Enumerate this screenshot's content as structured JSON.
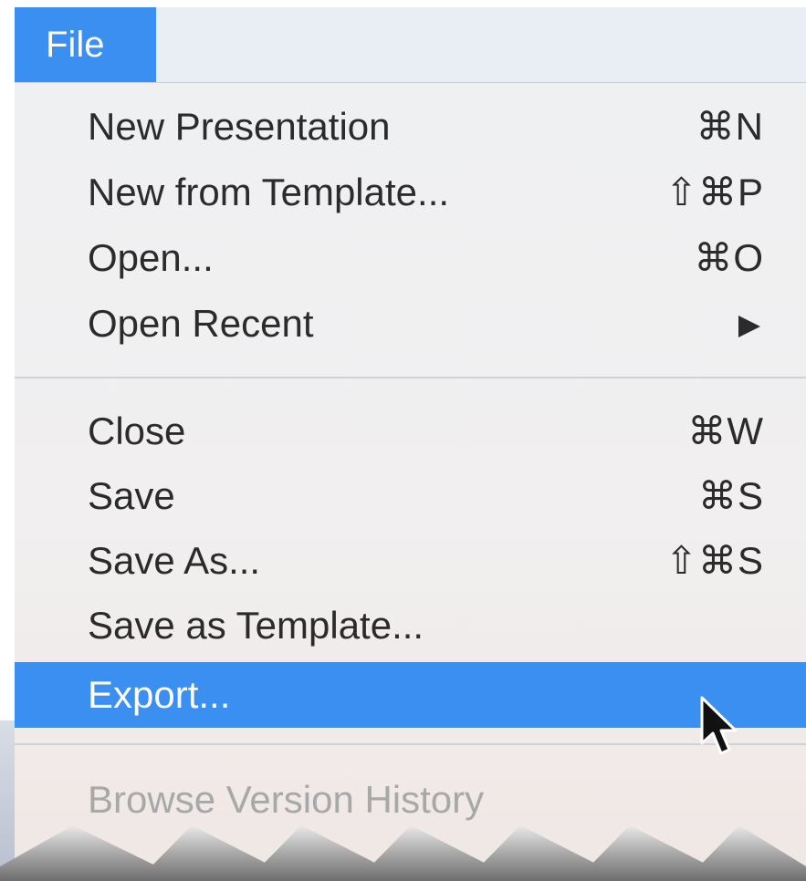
{
  "menu": {
    "title": "File",
    "items": [
      {
        "label": "New Presentation",
        "shortcut": "⌘N"
      },
      {
        "label": "New from Template...",
        "shortcut": "⇧⌘P"
      },
      {
        "label": "Open...",
        "shortcut": "⌘O"
      },
      {
        "label": "Open Recent",
        "submenu": true
      },
      {
        "label": "Close",
        "shortcut": "⌘W"
      },
      {
        "label": "Save",
        "shortcut": "⌘S"
      },
      {
        "label": "Save As...",
        "shortcut": "⇧⌘S"
      },
      {
        "label": "Save as Template..."
      },
      {
        "label": "Export...",
        "highlighted": true
      },
      {
        "label": "Browse Version History",
        "disabled": true
      }
    ]
  },
  "colors": {
    "accent": "#3b8ff1",
    "menu_bg": "#eff0f2",
    "text": "#2b2b2b",
    "disabled_text": "#a8a8a8"
  }
}
